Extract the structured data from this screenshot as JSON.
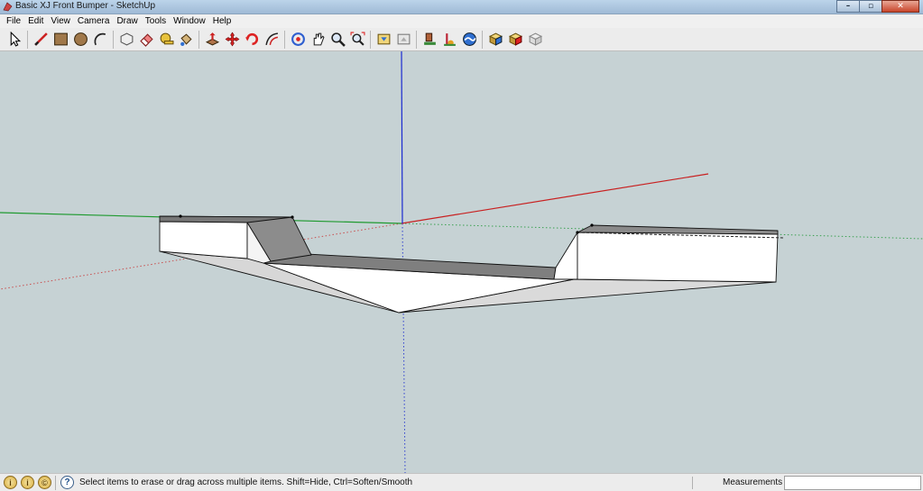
{
  "window": {
    "title": "Basic XJ Front Bumper - SketchUp",
    "minimize": "–",
    "restore": "▫",
    "close": "✕"
  },
  "menu": [
    "File",
    "Edit",
    "View",
    "Camera",
    "Draw",
    "Tools",
    "Window",
    "Help"
  ],
  "toolbar": {
    "groups": [
      [
        "select-icon"
      ],
      [
        "line-icon",
        "rectangle-icon",
        "circle-icon",
        "arc-icon"
      ],
      [
        "make-component-icon",
        "eraser-icon",
        "tape-measure-icon",
        "paint-bucket-icon"
      ],
      [
        "push-pull-icon",
        "move-icon",
        "rotate-icon",
        "offset-icon"
      ],
      [
        "orbit-icon",
        "pan-icon",
        "zoom-icon",
        "zoom-extents-icon"
      ],
      [
        "get-models-icon",
        "share-model-icon"
      ],
      [
        "google-earth-view-icon",
        "google-earth-toggle-icon",
        "google-earth-terrain-icon"
      ],
      [
        "get-components-icon",
        "share-component-icon",
        "dynamic-component-icon"
      ]
    ]
  },
  "viewport": {
    "background": "#c6d2d4",
    "axes": {
      "x": "#cc2020",
      "y": "#2aa040",
      "z": "#1a2ad0"
    },
    "model": "front bumper (white faces, gray tops)"
  },
  "status": {
    "icons": [
      "i",
      "i",
      "©"
    ],
    "help_glyph": "?",
    "text": "Select items to erase or drag across multiple items. Shift=Hide, Ctrl=Soften/Smooth",
    "measurements_label": "Measurements",
    "measurements_value": ""
  }
}
